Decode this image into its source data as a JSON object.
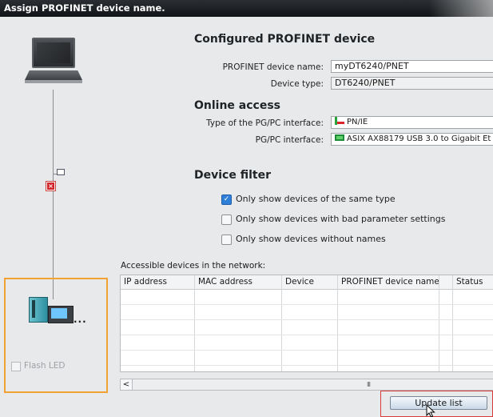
{
  "window": {
    "title": "Assign PROFINET device name."
  },
  "configured": {
    "heading": "Configured PROFINET device",
    "device_name_label": "PROFINET device name:",
    "device_name_value": "myDT6240/PNET",
    "device_type_label": "Device type:",
    "device_type_value": "DT6240/PNET"
  },
  "online": {
    "heading": "Online access",
    "interface_type_label": "Type of the PG/PC interface:",
    "interface_type_value": "PN/IE",
    "interface_label": "PG/PC interface:",
    "interface_value": "ASIX AX88179 USB 3.0 to Gigabit Et"
  },
  "filter": {
    "heading": "Device filter",
    "options": [
      {
        "label": "Only show devices of the same type",
        "checked": true
      },
      {
        "label": "Only show devices with bad parameter settings",
        "checked": false
      },
      {
        "label": "Only show devices without names",
        "checked": false
      }
    ]
  },
  "network": {
    "label": "Accessible devices in the network:",
    "columns": [
      "IP address",
      "MAC address",
      "Device",
      "PROFINET device name",
      "Status"
    ],
    "rows": []
  },
  "left": {
    "flash_led_label": "Flash LED",
    "device_more": "..."
  },
  "buttons": {
    "update_list": "Update list"
  },
  "icons": {
    "scroll_left": "<",
    "scroll_thumb": "III"
  },
  "colors": {
    "selection_border": "#f2a233",
    "highlight_border": "#d83a3a",
    "checkbox_accent": "#2f7fd8",
    "title_bar": "#1a1d20"
  }
}
